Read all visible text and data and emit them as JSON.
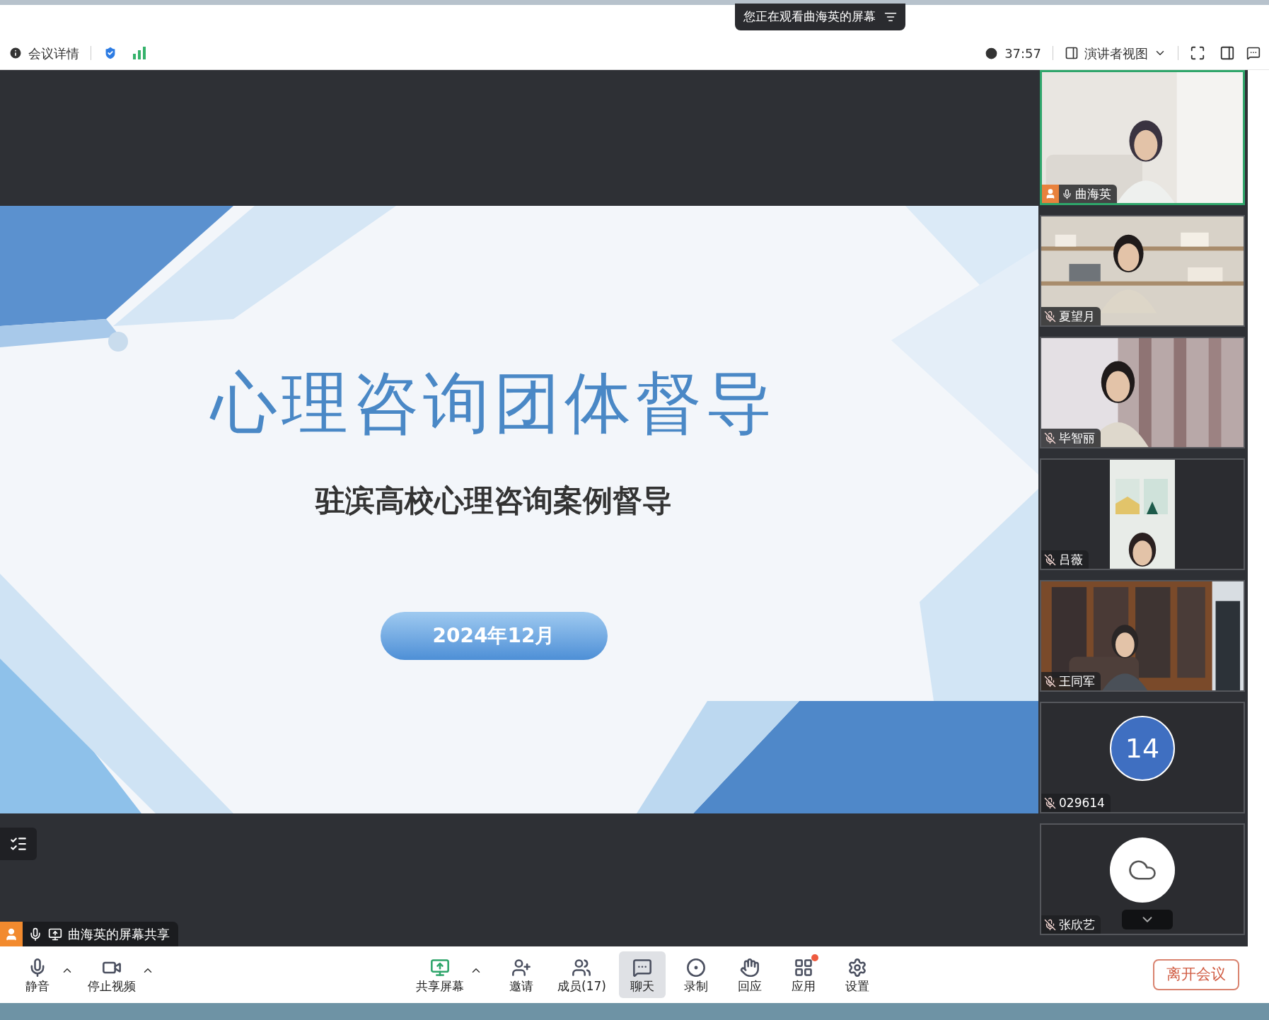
{
  "banner": {
    "text": "您正在观看曲海英的屏幕"
  },
  "info_bar": {
    "details": "会议详情",
    "timer": "37:57",
    "view": "演讲者视图"
  },
  "slide": {
    "title": "心理咨询团体督导",
    "subtitle": "驻滨高校心理咨询案例督导",
    "date": "2024年12月"
  },
  "share_label": {
    "text": "曲海英的屏幕共享"
  },
  "participants": [
    {
      "name": "曲海英",
      "kind": "video",
      "host": true,
      "muted": false,
      "active": true
    },
    {
      "name": "夏望月",
      "kind": "video",
      "host": false,
      "muted": true,
      "active": false
    },
    {
      "name": "毕智丽",
      "kind": "video",
      "host": false,
      "muted": true,
      "active": false
    },
    {
      "name": "吕薇",
      "kind": "portrait",
      "host": false,
      "muted": true,
      "active": false
    },
    {
      "name": "王同军",
      "kind": "video",
      "host": false,
      "muted": true,
      "active": false
    },
    {
      "name": "029614",
      "kind": "avatar",
      "avatar_text": "14",
      "host": false,
      "muted": true,
      "active": false
    },
    {
      "name": "张欣艺",
      "kind": "cloud",
      "host": false,
      "muted": true,
      "active": false
    }
  ],
  "toolbar": [
    {
      "label": "静音",
      "kind": "mic",
      "menu": true,
      "selected": false,
      "notification": false
    },
    {
      "label": "停止视频",
      "kind": "camera",
      "menu": true,
      "selected": false,
      "notification": false
    },
    {
      "label": "共享屏幕",
      "kind": "share",
      "menu": true,
      "selected": false,
      "notification": false
    },
    {
      "label": "邀请",
      "kind": "invite",
      "menu": false,
      "selected": false,
      "notification": false
    },
    {
      "label": "成员(17)",
      "kind": "members",
      "menu": false,
      "selected": false,
      "notification": false
    },
    {
      "label": "聊天",
      "kind": "chat",
      "menu": false,
      "selected": true,
      "notification": false
    },
    {
      "label": "录制",
      "kind": "record",
      "menu": false,
      "selected": false,
      "notification": false
    },
    {
      "label": "回应",
      "kind": "react",
      "menu": false,
      "selected": false,
      "notification": false
    },
    {
      "label": "应用",
      "kind": "apps",
      "menu": false,
      "selected": false,
      "notification": true
    },
    {
      "label": "设置",
      "kind": "settings",
      "menu": false,
      "selected": false,
      "notification": false
    }
  ],
  "leave_button": "离开会议"
}
